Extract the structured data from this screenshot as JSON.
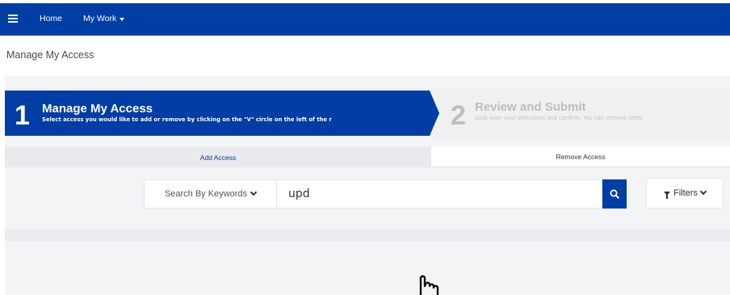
{
  "navbar": {
    "home_label": "Home",
    "mywork_label": "My Work"
  },
  "page": {
    "title": "Manage My Access"
  },
  "steps": [
    {
      "number": "1",
      "title": "Manage My Access",
      "description": "Select access you would like to add or remove by clicking on the \"V\" circle on the left of the r",
      "active": true
    },
    {
      "number": "2",
      "title": "Review and Submit",
      "description": "Look over your selections and confirm. You can remove selec",
      "active": false
    }
  ],
  "tabs": {
    "add_label": "Add Access",
    "remove_label": "Remove Access"
  },
  "search": {
    "mode_label": "Search By Keywords",
    "value": "upd",
    "filters_label": "Filters"
  },
  "icons": {
    "menu": "hamburger-menu-icon",
    "search": "search-icon",
    "filter": "filter-icon",
    "pointer": "hand-pointer-icon"
  },
  "colors": {
    "brand_blue": "#003da5",
    "content_bg": "#f3f4f6"
  }
}
